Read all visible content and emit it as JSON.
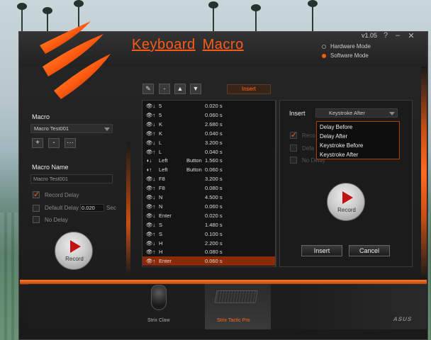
{
  "app": {
    "title_word1": "Keyboard",
    "title_word2": "Macro",
    "version": "v1.05",
    "help": "?",
    "minimize": "–",
    "close": "✕",
    "accent_color": "#ff5a1a"
  },
  "mode": {
    "hardware_label": "Hardware Mode",
    "software_label": "Software Mode",
    "selected": "software"
  },
  "left": {
    "macro_label": "Macro",
    "macro_selected": "Macro Test001",
    "add": "+",
    "remove": "-",
    "more": "···",
    "macro_name_label": "Macro  Name",
    "macro_name_value": "Macro Test001",
    "record_delay_label": "Record Delay",
    "record_delay_checked": true,
    "default_delay_label": "Default Delay",
    "default_delay_value": "0.020",
    "default_delay_unit": "Sec",
    "no_delay_label": "No Delay",
    "record_label": "Record"
  },
  "toolbar": {
    "edit_icon": "✎",
    "minus": "-",
    "up": "▲",
    "down": "▼",
    "insert_label": "Insert"
  },
  "macro_list": [
    {
      "icon": "👁↓",
      "key": "5",
      "key2": "",
      "value": "0.020 s"
    },
    {
      "icon": "👁↑",
      "key": "5",
      "key2": "",
      "value": "0.060 s"
    },
    {
      "icon": "👁↓",
      "key": "K",
      "key2": "",
      "value": "2.680 s"
    },
    {
      "icon": "👁↑",
      "key": "K",
      "key2": "",
      "value": "0.040 s"
    },
    {
      "icon": "👁↓",
      "key": "L",
      "key2": "",
      "value": "3.200 s"
    },
    {
      "icon": "👁↑",
      "key": "L",
      "key2": "",
      "value": "0.040 s"
    },
    {
      "icon": "◖↓",
      "key": "Left",
      "key2": "Button",
      "value": "1.560 s"
    },
    {
      "icon": "◖↑",
      "key": "Left",
      "key2": "Button",
      "value": "0.060 s"
    },
    {
      "icon": "👁↓",
      "key": "F8",
      "key2": "",
      "value": "3.200 s"
    },
    {
      "icon": "👁↑",
      "key": "F8",
      "key2": "",
      "value": "0.080 s"
    },
    {
      "icon": "👁↓",
      "key": "N",
      "key2": "",
      "value": "4.500 s"
    },
    {
      "icon": "👁↑",
      "key": "N",
      "key2": "",
      "value": "0.060 s"
    },
    {
      "icon": "👁↓",
      "key": "Enter",
      "key2": "",
      "value": "0.020 s"
    },
    {
      "icon": "👁↓",
      "key": "S",
      "key2": "",
      "value": "1.480 s"
    },
    {
      "icon": "👁↑",
      "key": "S",
      "key2": "",
      "value": "0.100 s"
    },
    {
      "icon": "👁↓",
      "key": "H",
      "key2": "",
      "value": "2.200 s"
    },
    {
      "icon": "👁↑",
      "key": "H",
      "key2": "",
      "value": "0.080 s"
    },
    {
      "icon": "👁↑",
      "key": "Enter",
      "key2": "",
      "value": "0.060 s",
      "selected": true
    }
  ],
  "insert_panel": {
    "insert_label": "Insert",
    "selected_type": "Keystroke After",
    "options": [
      "Delay Before",
      "Delay After",
      "Keystroke Before",
      "Keystroke After"
    ],
    "ghost_record": "Reco",
    "ghost_default": "Defa",
    "ghost_no_delay": "No Delay",
    "record_label": "Record",
    "insert_button": "Insert",
    "cancel_button": "Cancel"
  },
  "devices": {
    "claw": "Strix Claw",
    "tactic": "Strix Tactic Pro",
    "brand": "ASUS"
  }
}
